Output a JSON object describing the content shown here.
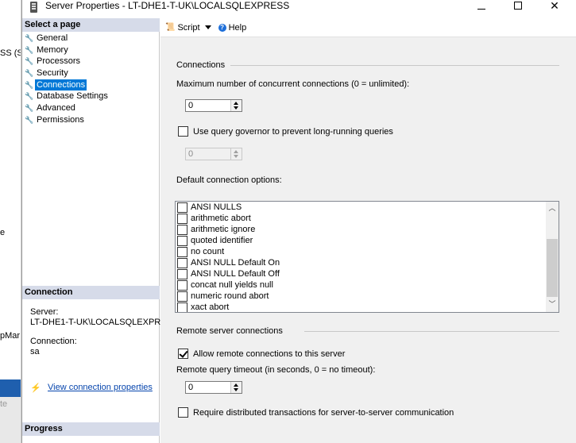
{
  "background_app": {
    "fragments": [
      "SS (S",
      "e",
      "pMar",
      "te"
    ]
  },
  "window": {
    "title": "Server Properties - LT-DHE1-T-UK\\LOCALSQLEXPRESS",
    "minimize_glyph": "",
    "close_glyph": "✕"
  },
  "left_panel": {
    "select_page_header": "Select a page",
    "pages": [
      {
        "label": "General",
        "selected": false
      },
      {
        "label": "Memory",
        "selected": false
      },
      {
        "label": "Processors",
        "selected": false
      },
      {
        "label": "Security",
        "selected": false
      },
      {
        "label": "Connections",
        "selected": true
      },
      {
        "label": "Database Settings",
        "selected": false
      },
      {
        "label": "Advanced",
        "selected": false
      },
      {
        "label": "Permissions",
        "selected": false
      }
    ],
    "connection_header": "Connection",
    "server_label": "Server:",
    "server_value": "LT-DHE1-T-UK\\LOCALSQLEXPRE",
    "connection_label": "Connection:",
    "connection_value": "sa",
    "view_link": "View connection properties",
    "progress_header": "Progress"
  },
  "toolbar": {
    "script_label": "Script",
    "help_label": "Help"
  },
  "connections": {
    "group_label": "Connections",
    "max_conn_label": "Maximum number of concurrent connections (0 = unlimited):",
    "max_conn_value": "0",
    "query_governor_label": "Use query governor to prevent long-running queries",
    "query_governor_checked": false,
    "query_governor_value": "0",
    "default_options_label": "Default connection options:",
    "options": [
      {
        "label": "ANSI NULLS",
        "checked": false
      },
      {
        "label": "arithmetic abort",
        "checked": false
      },
      {
        "label": "arithmetic ignore",
        "checked": false
      },
      {
        "label": "quoted identifier",
        "checked": false
      },
      {
        "label": "no count",
        "checked": false
      },
      {
        "label": "ANSI NULL Default On",
        "checked": false
      },
      {
        "label": "ANSI NULL Default Off",
        "checked": false
      },
      {
        "label": "concat null yields null",
        "checked": false
      },
      {
        "label": "numeric round abort",
        "checked": false
      },
      {
        "label": "xact abort",
        "checked": false
      }
    ]
  },
  "remote": {
    "group_label": "Remote server connections",
    "allow_remote_label": "Allow remote connections to this server",
    "allow_remote_checked": true,
    "timeout_label": "Remote query timeout (in seconds, 0 = no timeout):",
    "timeout_value": "0",
    "distributed_label": "Require distributed transactions for server-to-server communication",
    "distributed_checked": false
  }
}
